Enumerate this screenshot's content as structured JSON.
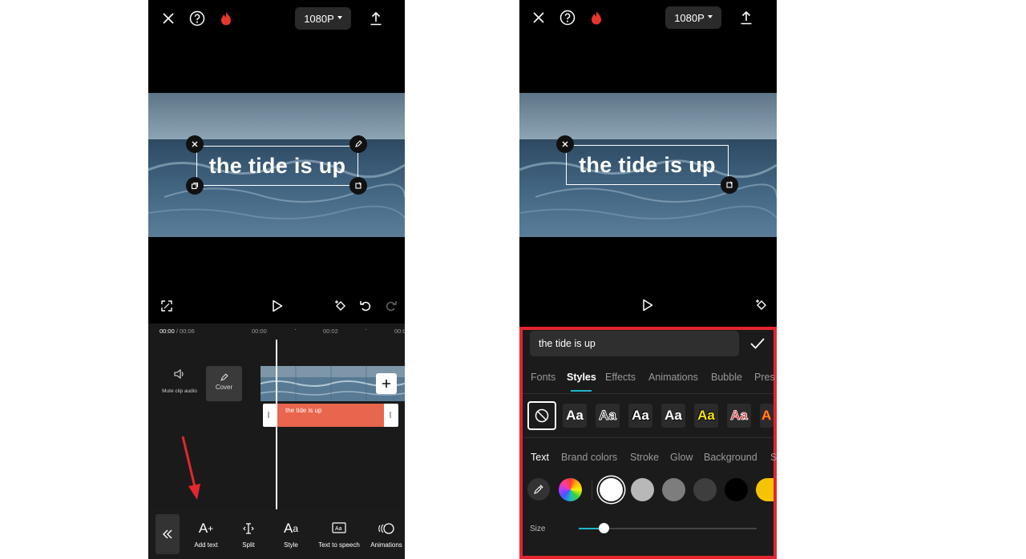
{
  "left_screen": {
    "resolution": "1080P",
    "text_overlay": "the tide is up",
    "timecode_current": "00:00",
    "timecode_total": "/ 00:06",
    "ruler_marks": [
      "00:00",
      "00:02",
      "00:0"
    ],
    "mute_label": "Mute clip audio",
    "cover_label": "Cover",
    "text_clip": "the tide is up",
    "tools": [
      {
        "label": "Add text",
        "icon": "add-text-icon"
      },
      {
        "label": "Split",
        "icon": "split-icon"
      },
      {
        "label": "Style",
        "icon": "style-icon"
      },
      {
        "label": "Text to speech",
        "icon": "text-to-speech-icon"
      },
      {
        "label": "Animations",
        "icon": "animations-icon"
      }
    ]
  },
  "right_screen": {
    "resolution": "1080P",
    "text_overlay": "the tide is up",
    "text_input_value": "the tide is up",
    "tabs": [
      "Fonts",
      "Styles",
      "Effects",
      "Animations",
      "Bubble",
      "Pres"
    ],
    "active_tab": "Styles",
    "style_presets": [
      "Aa",
      "Aa",
      "Aa",
      "Aa",
      "Aa",
      "Aa",
      "A"
    ],
    "subtabs": [
      "Text",
      "Brand colors",
      "Stroke",
      "Glow",
      "Background",
      "S"
    ],
    "active_subtab": "Text",
    "swatches": [
      "#ffffff",
      "#b8b8b8",
      "#7d7d7d",
      "#3e3e3e",
      "#000000",
      "#f5c400"
    ],
    "size_label": "Size",
    "size_fraction": 0.14
  },
  "colors": {
    "accent": "#1fb6c9",
    "highlight_border": "#e4262e",
    "text_clip": "#e8664e",
    "arrow": "#e4262e",
    "flame": "#e8362f"
  }
}
